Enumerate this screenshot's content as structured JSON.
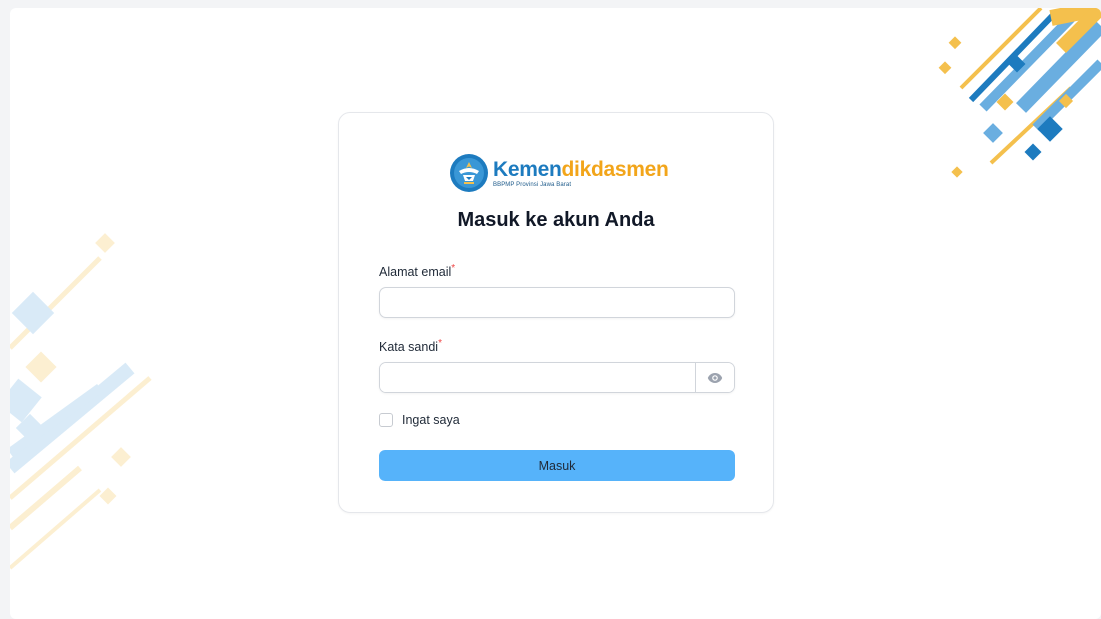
{
  "brand": {
    "name_part1": "Kemen",
    "name_part2": "dikdasmen",
    "subtitle": "BBPMP Provinsi Jawa Barat",
    "colors": {
      "blue": "#1d7bbf",
      "gold": "#f2a51a"
    }
  },
  "login": {
    "title": "Masuk ke akun Anda",
    "email_label": "Alamat email",
    "email_value": "",
    "password_label": "Kata sandi",
    "password_value": "",
    "required_mark": "*",
    "show_password_icon": "eye-icon",
    "remember_label": "Ingat saya",
    "remember_checked": false,
    "submit_label": "Masuk"
  },
  "colors": {
    "accent": "#56b3fa",
    "required": "#ef4444"
  }
}
